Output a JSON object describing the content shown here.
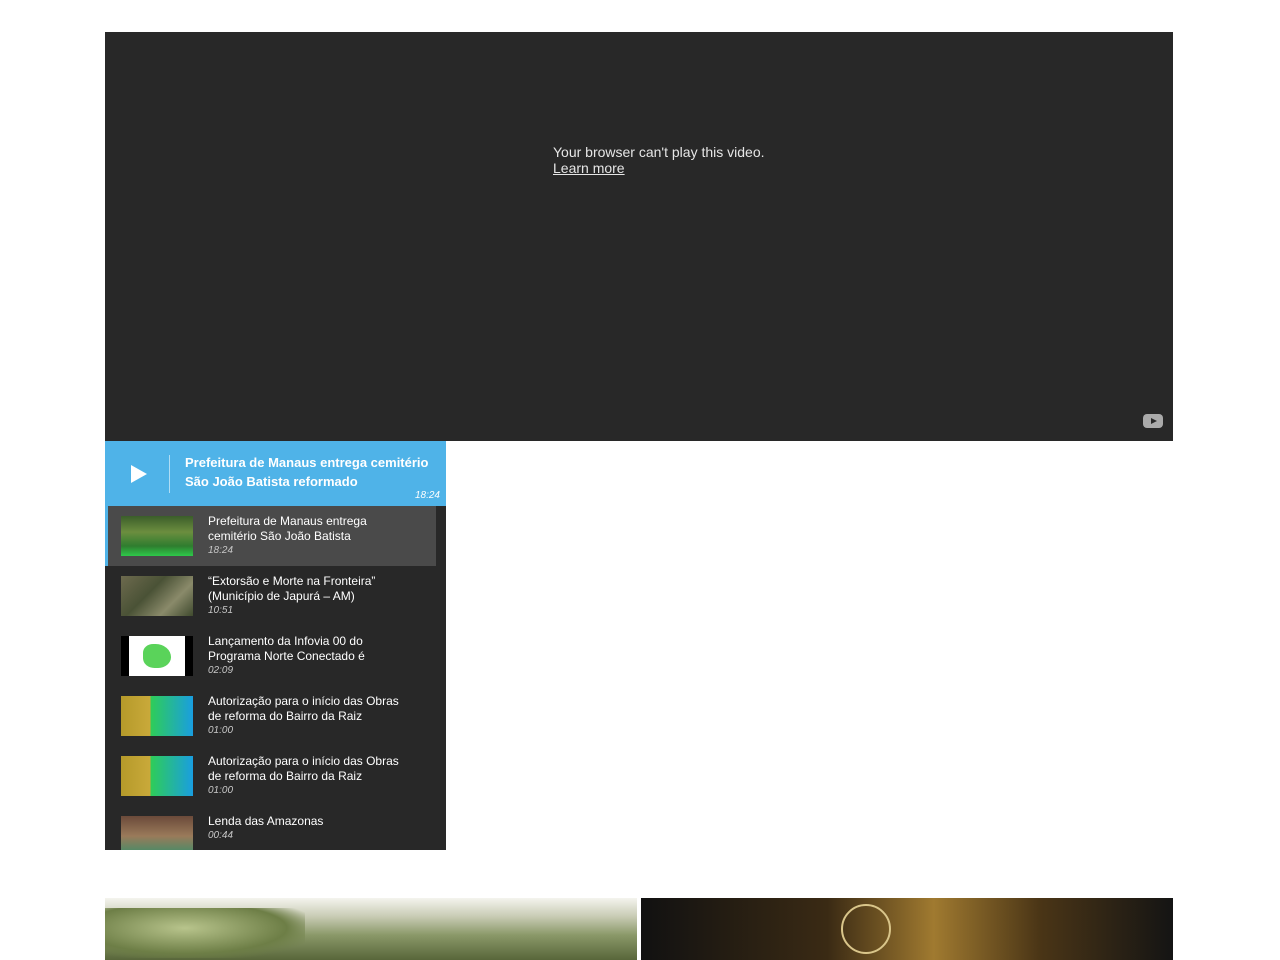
{
  "video": {
    "message": "Your browser can't play this video.",
    "learn_more": "Learn more"
  },
  "now_playing": {
    "title": "Prefeitura de Manaus entrega cemitério São João Batista reformado",
    "duration": "18:24"
  },
  "playlist": [
    {
      "title": "Prefeitura de Manaus entrega cemitério São João Batista",
      "duration": "18:24"
    },
    {
      "title": "“Extorsão e Morte na Fronteira” (Município de Japurá – AM)",
      "duration": "10:51"
    },
    {
      "title": "Lançamento da Infovia 00 do Programa Norte Conectado é",
      "duration": "02:09"
    },
    {
      "title": "Autorização para o início das Obras de reforma do Bairro da Raiz",
      "duration": "01:00"
    },
    {
      "title": "Autorização para o início das Obras de reforma do Bairro da Raiz",
      "duration": "01:00"
    },
    {
      "title": "Lenda das Amazonas",
      "duration": "00:44"
    }
  ],
  "colors": {
    "accent": "#4fb3e8",
    "player_bg": "#282828"
  }
}
